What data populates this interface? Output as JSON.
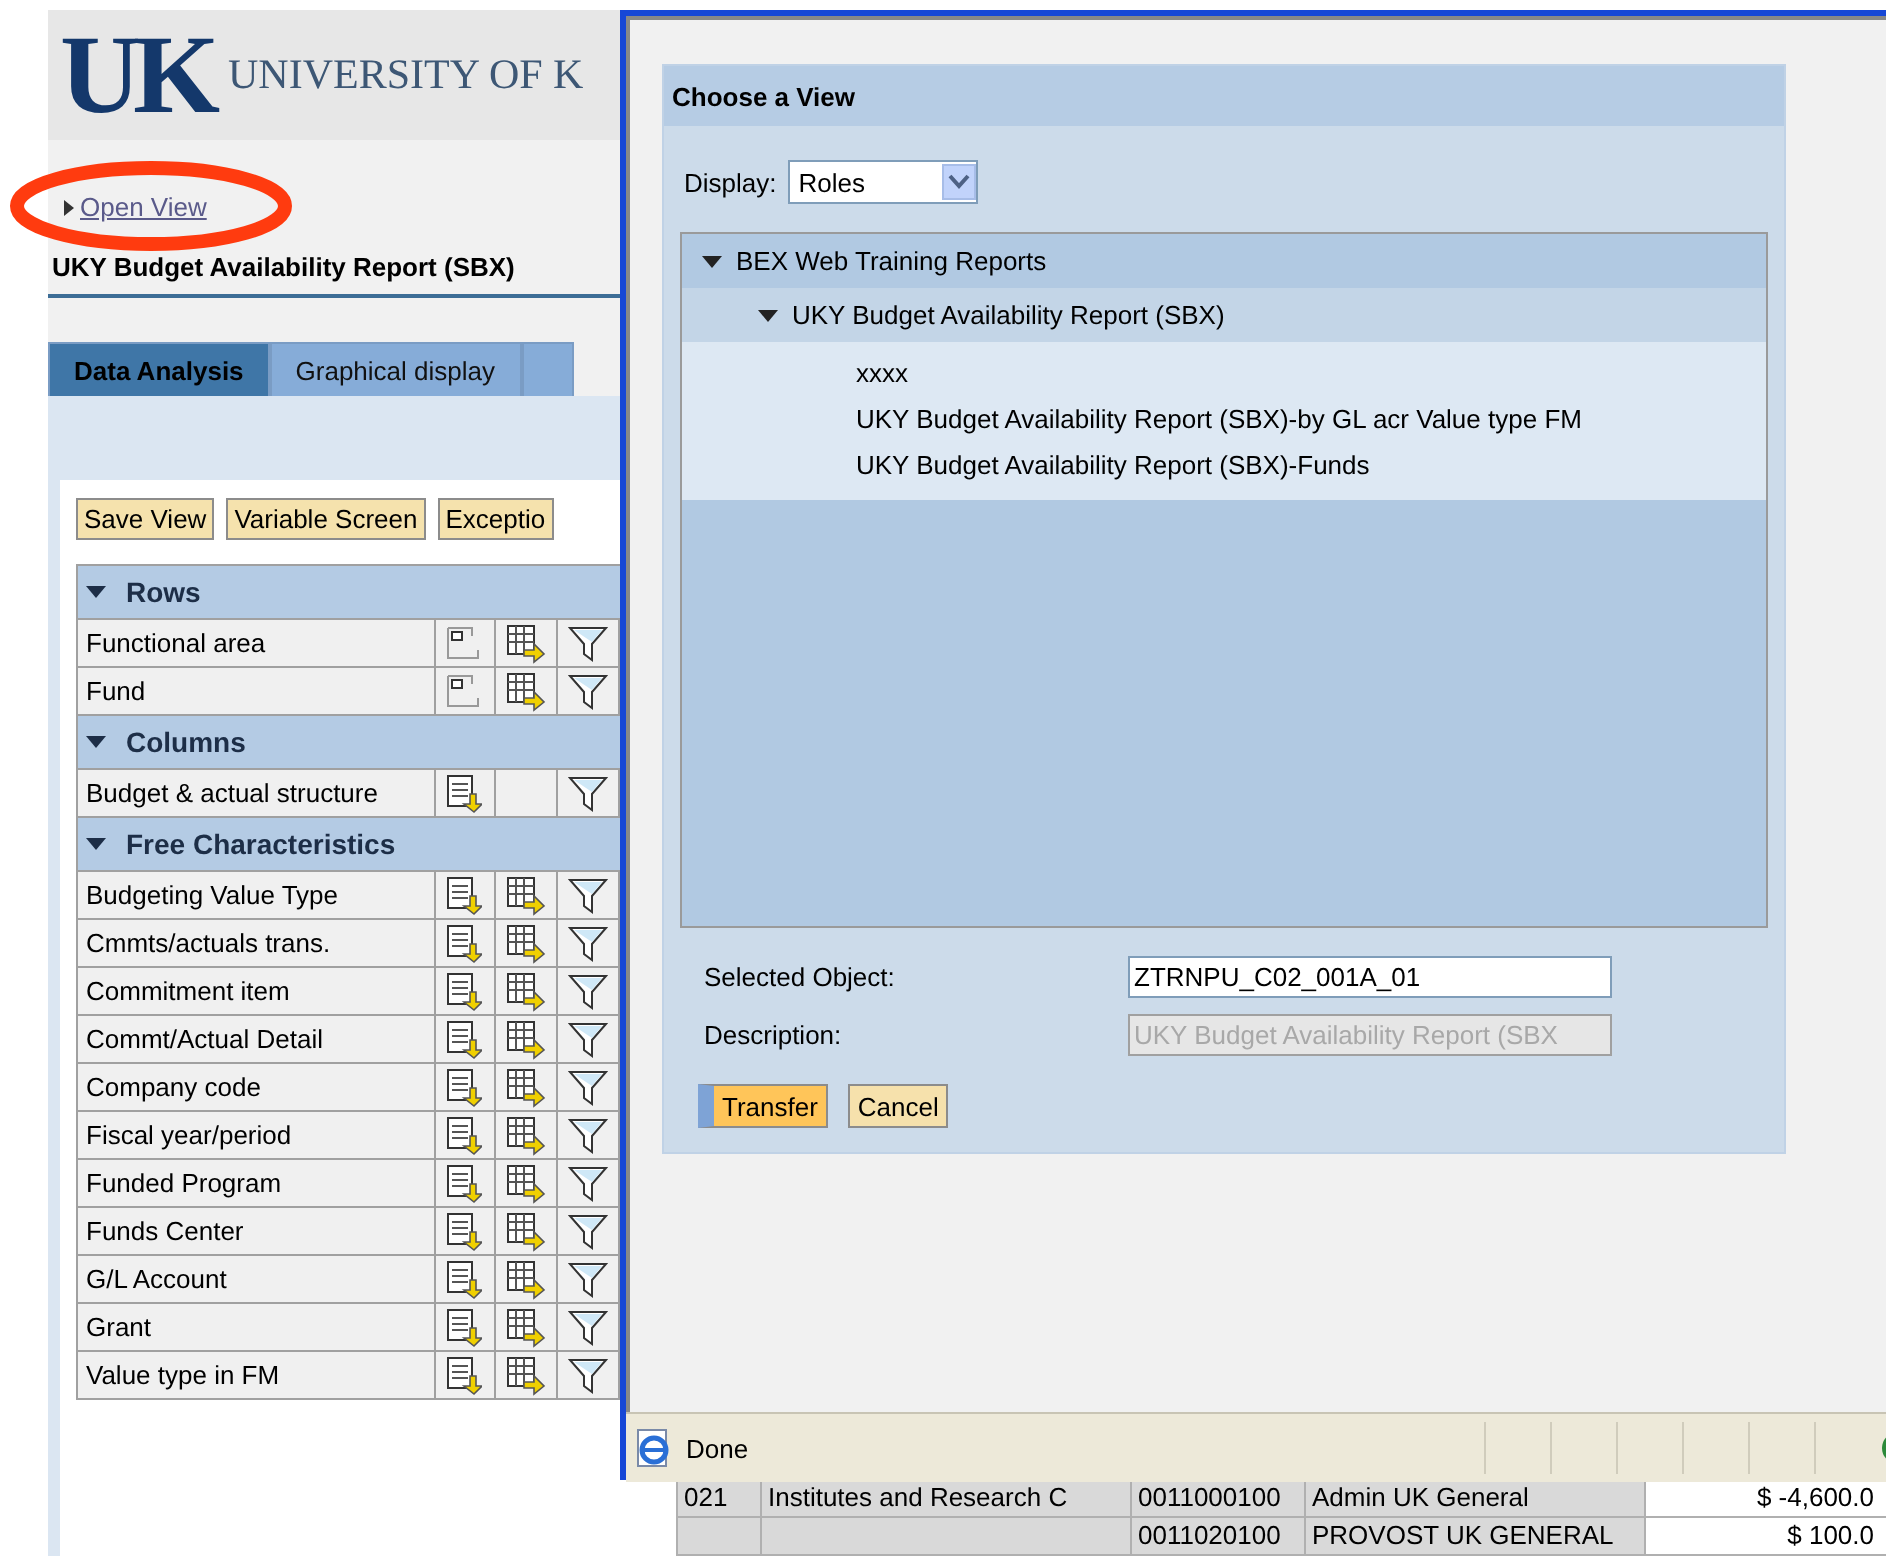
{
  "header": {
    "logo_text": "UK",
    "institution": "UNIVERSITY OF K"
  },
  "open_view_link": "Open View",
  "report_title": "UKY Budget Availability Report (SBX)",
  "tabs": [
    {
      "label": "Data Analysis",
      "selected": true
    },
    {
      "label": "Graphical display",
      "selected": false
    },
    {
      "selected": false
    }
  ],
  "toolbar": [
    "Save View",
    "Variable Screen",
    "Exceptio"
  ],
  "navigation": [
    {
      "title": "Rows",
      "kind": "rows",
      "expanded": true,
      "items": [
        "Functional area",
        "Fund"
      ]
    },
    {
      "title": "Columns",
      "kind": "columns",
      "expanded": true,
      "items": [
        "Budget & actual structure"
      ]
    },
    {
      "title": "Free Characteristics",
      "kind": "free",
      "expanded": true,
      "items": [
        "Budgeting Value Type",
        "Cmmts/actuals trans.",
        "Commitment item",
        "Commt/Actual Detail",
        "Company code",
        "Fiscal year/period",
        "Funded Program",
        "Funds Center",
        "G/L Account",
        "Grant",
        "Value type in FM"
      ]
    }
  ],
  "dialog": {
    "title": "Choose a View",
    "display_label": "Display:",
    "display_value": "Roles",
    "tree": [
      {
        "label": "BEX Web Training Reports",
        "expanded": true,
        "children": [
          {
            "label": "UKY Budget Availability Report (SBX)",
            "expanded": true,
            "children": [
              {
                "label": "xxxx"
              },
              {
                "label": "UKY Budget Availability Report (SBX)-by GL acr Value type FM"
              },
              {
                "label": "UKY Budget Availability Report (SBX)-Funds"
              }
            ]
          }
        ]
      }
    ],
    "selected_object": {
      "label": "Selected Object:",
      "value": "ZTRNPU_C02_001A_01"
    },
    "description": {
      "label": "Description:",
      "value": "UKY Budget Availability Report (SBX",
      "disabled": true
    },
    "buttons": [
      {
        "label": "Transfer",
        "kind": "primary",
        "focused": true
      },
      {
        "label": "Cancel",
        "kind": "secondary",
        "focused": false
      }
    ]
  },
  "status_bar": {
    "text": "Done"
  },
  "background_table": {
    "rows": [
      {
        "column_1": "021",
        "column_2": "Institutes and Research C",
        "column_3": "0011000100",
        "column_4": "Admin UK General",
        "column_5": "$ -4,600.0"
      },
      {
        "column_3": "0011020100",
        "column_4": "PROVOST UK GENERAL",
        "column_5": "$ 100.0"
      }
    ]
  }
}
